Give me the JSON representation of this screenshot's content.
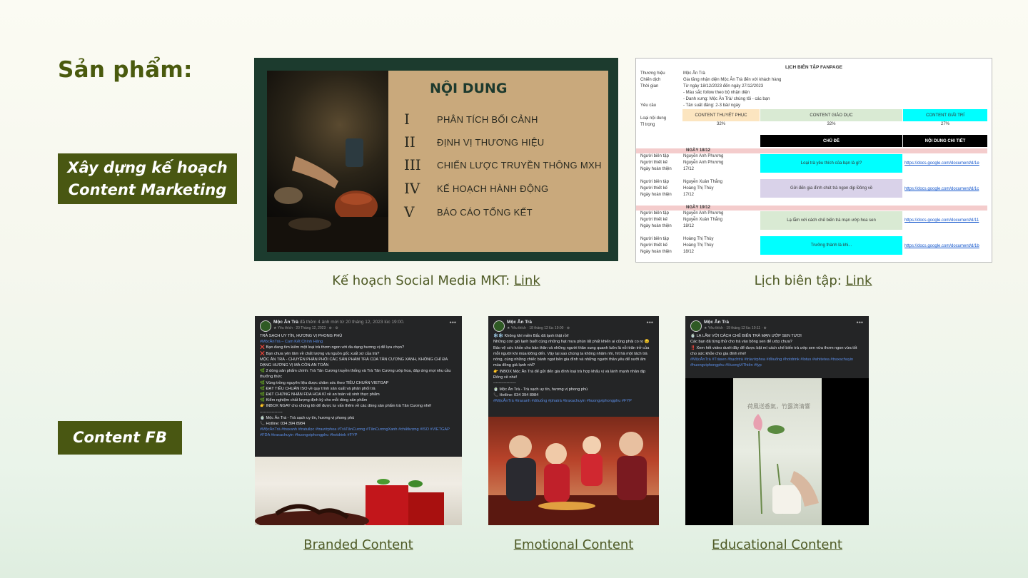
{
  "title": "Sản phẩm:",
  "badges": {
    "plan_line1": "Xây dựng kế hoạch",
    "plan_line2": "Content Marketing",
    "fb": "Content FB"
  },
  "slide": {
    "heading": "NỘI DUNG",
    "items": [
      {
        "num": "I",
        "text": "PHÂN TÍCH BỐI CẢNH"
      },
      {
        "num": "II",
        "text": "ĐỊNH VỊ THƯƠNG HIỆU"
      },
      {
        "num": "III",
        "text": "CHIẾN LƯỢC TRUYỀN THÔNG MXH"
      },
      {
        "num": "IV",
        "text": "KẾ HOẠCH HÀNH ĐỘNG"
      },
      {
        "num": "V",
        "text": "BÁO CÁO TỔNG KẾT"
      }
    ]
  },
  "sheet": {
    "title": "LỊCH BIÊN TẬP FANPAGE",
    "rows": [
      {
        "k": "Thương hiệu",
        "v": "Mộc Ân Trà"
      },
      {
        "k": "Chiến dịch",
        "v": "Gia tăng nhận diện Mộc Ân Trà đến với khách hàng"
      },
      {
        "k": "Thời gian",
        "v": "Từ ngày 18/12/2023 đến ngày 27/12/2023"
      },
      {
        "k": "",
        "v": "- Màu sắc follow theo bộ nhận diện"
      },
      {
        "k": "",
        "v": "- Danh xưng: Mộc Ân Trà/ chúng tôi - các bạn"
      },
      {
        "k": "Yêu cầu",
        "v": "- Tần suất đăng: 2-3 bài/ ngày"
      }
    ],
    "type_label": "Loại nội dung",
    "ratio_label": "Tỉ trọng",
    "types": [
      {
        "name": "CONTENT THUYẾT PHỤC",
        "pct": "32%",
        "color": "#fce5c0"
      },
      {
        "name": "CONTENT GIÁO DỤC",
        "pct": "32%",
        "color": "#d9ead3"
      },
      {
        "name": "CONTENT GIẢI TRÍ",
        "pct": "27%",
        "color": "#00ffff"
      }
    ],
    "col_topic": "CHỦ ĐỀ",
    "col_detail": "NỘI DUNG CHI TIẾT",
    "days": [
      "NGÀY 18/12",
      "NGÀY 19/12"
    ],
    "labels": [
      "Người biên tập",
      "Người thiết kế",
      "Ngày hoàn thiện"
    ],
    "entries": [
      {
        "editor": "Nguyễn Anh Phương",
        "designer": "Nguyễn Anh Phương",
        "date": "17/12",
        "topic": "Loại trà yêu thích của bạn là gì?",
        "color": "#00ffff",
        "link": "https://docs.google.com/document/d/1e"
      },
      {
        "editor": "Nguyễn Xuân Thắng",
        "designer": "Hoàng Thị Thùy",
        "date": "17/12",
        "topic": "Gửi đến gia đình chút trà ngon dịp Đông về",
        "color": "#d9d2e9",
        "link": "https://docs.google.com/document/d/1c"
      },
      {
        "editor": "Nguyễn Anh Phương",
        "designer": "Nguyễn Xuân Thắng",
        "date": "18/12",
        "topic": "Lạ lẫm với cách chế biến trà mạn ướp hoa sen",
        "color": "#d9ead3",
        "link": "https://docs.google.com/document/d/11"
      },
      {
        "editor": "Hoàng Thị Thùy",
        "designer": "Hoàng Thị Thùy",
        "date": "18/12",
        "topic": "Trưởng thành là khi...",
        "color": "#00ffff",
        "link": "https://docs.google.com/document/d/1b"
      }
    ]
  },
  "captions": {
    "plan_prefix": "Kế hoạch Social Media MKT: ",
    "plan_link": "Link",
    "calendar_prefix": "Lịch biên tập: ",
    "calendar_link": "Link",
    "branded": "Branded Content",
    "emotional": "Emotional Content",
    "educational": "Educational Content"
  },
  "posts": [
    {
      "name": "Mộc Ân Trà",
      "meta_a": "đã thêm 4 ảnh mới từ 20 tháng 12, 2023 lúc 19:00.",
      "meta_b": "★ Yêu thích · 20 Tháng 12, 2023 · ⊕ · ⚙",
      "lines": [
        "TRÀ SẠCH UY TÍN, HƯƠNG VỊ PHONG PHÚ",
        "#MộcÂnTrà – Cam Kết Chính Hãng",
        "❌ Bạn đang tìm kiếm một loại trà thơm ngon với đa dạng hương vị để lựa chọn?",
        "❌ Bạn chưa yên tâm về chất lượng và nguồn gốc xuất xứ của trà?",
        "MỘC ÂN TRÀ - CHUYÊN PHÂN PHỐI CÁC SẢN PHẨM TRÀ CỦA TÂN CƯƠNG XANH, KHÔNG CHỈ ĐA DẠNG HƯƠNG VỊ MÀ CÒN AN TOÀN",
        "🌿 2 dòng sản phẩm chính: Trà Tân Cương truyền thống và Trà Tân Cương ướp hoa, đáp ứng mọi nhu cầu thưởng thức",
        "🌿 Vùng trồng nguyên liệu được chăm sóc theo TIÊU CHUẨN VIETGAP",
        "🌿 ĐẠT TIÊU CHUẨN ISO về quy trình sản xuất và phân phối trà",
        "🌿 ĐẠT CHỨNG NHẬN FDA HOA KÌ về an toàn vệ sinh thực phẩm",
        "🌿 Kiểm nghiệm chất lượng định kỳ cho mỗi dòng sản phẩm",
        "👉 INBOX NGAY cho chúng tôi để được tư vấn thêm về các dòng sản phẩm trà Tân Cương nhé!",
        "-----------------",
        "🍵 Mộc Ân Trà - Trà sạch uy tín, hương vị phong phú",
        "📞 Hotline: 034 394 8984"
      ],
      "tags": "#MộcÂnTrà #traxanh #tratuilọc #traướphoa #TràTânCương #TânCươngXanh #chấtlượng #ISO #VIETGAP #FDA #traxachuyin #huongviphongphu #hotdrink #FYP"
    },
    {
      "name": "Mộc Ân Trà",
      "meta_a": "",
      "meta_b": "★ Yêu thích · 18 tháng 12 lúc 19:00 · ⊕",
      "lines": [
        "❄️❄️ Không khí miền Bắc đã lạnh thật rồi!",
        "Những cơn gió lạnh buốt cùng những hạt mưa phùn lất phất khiến ai cũng phải co ro 😣",
        "Bảo vệ sức khỏe cho bản thân và những người thân xung quanh luôn là nỗi trăn trở của mỗi người khi mùa Đông đến. Vậy tại sao chúng ta không nhâm nhi, hít hà một tách trà nóng, cùng những chiếc bánh ngọt bên gia đình và những người thân yêu để sưởi ấm mùa đông giá lạnh nhỉ?",
        "👉 INBOX Mộc Ân Trà để gửi đến gia đình loại trà hợp khẩu vị và lành mạnh nhân dịp Đông về nhé!",
        "-----------------",
        "🍵 Mộc Ân Trà - Trà sạch uy tín, hương vị phong phú",
        "📞 Hotline: 034 394 8984"
      ],
      "tags": "#MộcÂnTrà #traxanh #dôuống #phatrà #traxachuyin #huongviphongphu #FYP"
    },
    {
      "name": "Mộc Ân Trà",
      "meta_a": "",
      "meta_b": "★ Yêu thích · 19 tháng 12 lúc 10:11 · ⊕",
      "lines": [
        "🍵 LẠ LẪM VỚI CÁCH CHẾ BIẾN TRÀ MẠN ƯỚP SEN TƯƠI",
        "Các bạn đã từng thử cho trà vào bông sen để ướp chưa?",
        "‼️ Xem hết video dưới đây để được bật mí cách chế biến trà ướp sen vừa thơm ngon vừa tốt cho sức khỏe cho gia đình nhé!"
      ],
      "tags": "#MộcÂnTrà #Tràsen #bạchtrà #tràướphoa #đồuống #hotdrink #lotus #whitetea #traxachuyin #huongviphongphu #HuongViThiên #fyp",
      "video_text": "荷風送香氣，竹露滴清響"
    }
  ]
}
